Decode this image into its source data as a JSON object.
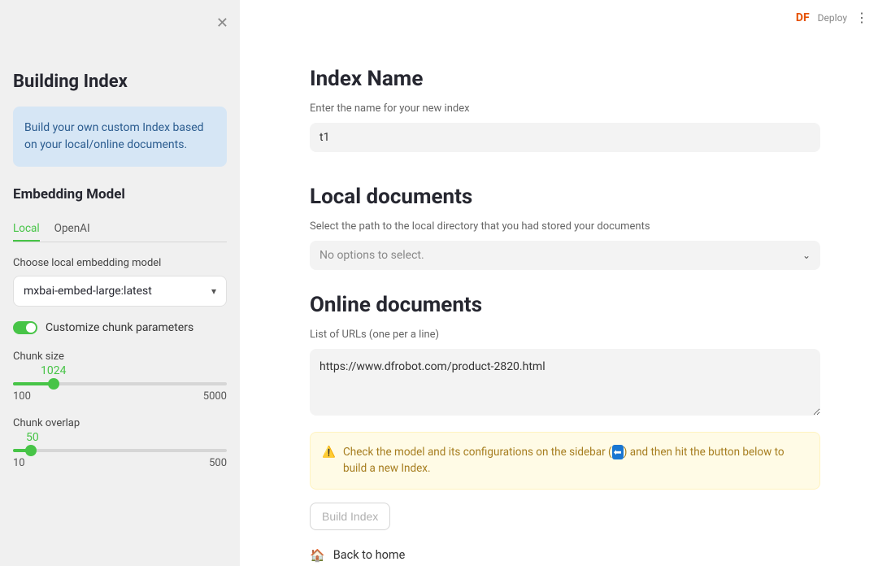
{
  "brand": "DF",
  "topbar": {
    "deploy": "Deploy"
  },
  "sidebar": {
    "title": "Building Index",
    "info": "Build your own custom Index based on your local/online documents.",
    "embedding_heading": "Embedding Model",
    "tabs": {
      "local": "Local",
      "openai": "OpenAI"
    },
    "choose_label": "Choose local embedding model",
    "model_value": "mxbai-embed-large:latest",
    "toggle_label": "Customize chunk parameters",
    "toggle_on": true,
    "chunk_size": {
      "label": "Chunk size",
      "value": 1024,
      "min": 100,
      "max": 5000
    },
    "chunk_overlap": {
      "label": "Chunk overlap",
      "value": 50,
      "min": 10,
      "max": 500
    }
  },
  "main": {
    "index_name_heading": "Index Name",
    "index_name_desc": "Enter the name for your new index",
    "index_name_value": "t1",
    "local_docs_heading": "Local documents",
    "local_docs_desc": "Select the path to the local directory that you had stored your documents",
    "local_docs_placeholder": "No options to select.",
    "online_docs_heading": "Online documents",
    "urls_label": "List of URLs (one per a line)",
    "urls_value": "https://www.dfrobot.com/product-2820.html",
    "warning": {
      "pre": "Check the model and its configurations on the sidebar (",
      "post": ") and then hit the button below to build a new Index."
    },
    "build_btn": "Build Index",
    "back_home": "Back to home"
  }
}
